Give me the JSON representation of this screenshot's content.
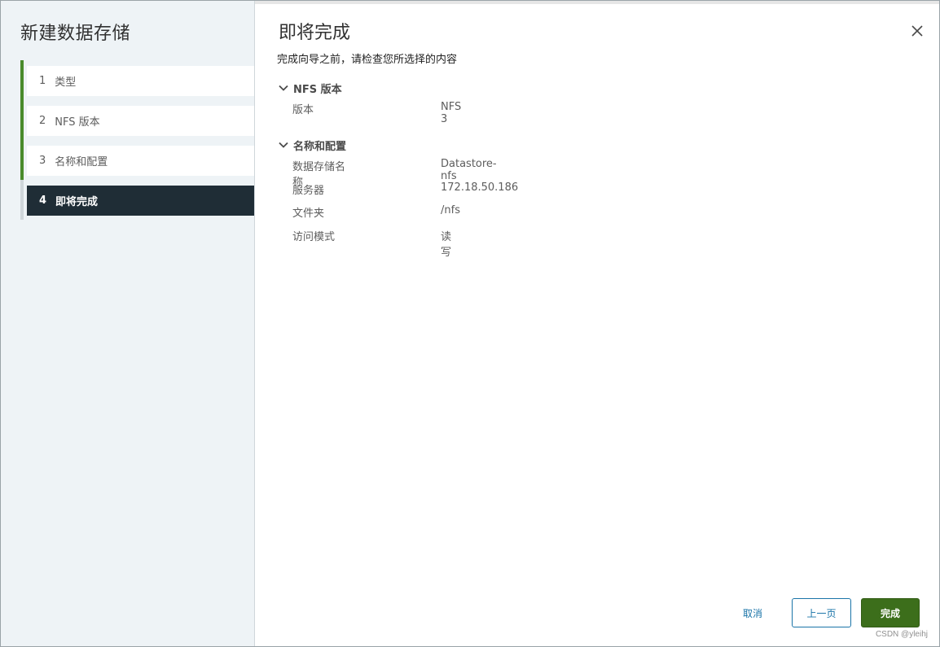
{
  "wizard": {
    "title": "新建数据存储",
    "steps": [
      {
        "num": "1",
        "label": "类型"
      },
      {
        "num": "2",
        "label": "NFS 版本"
      },
      {
        "num": "3",
        "label": "名称和配置"
      },
      {
        "num": "4",
        "label": "即将完成"
      }
    ],
    "active_step": "4"
  },
  "main": {
    "title": "即将完成",
    "subtitle": "完成向导之前，请检查您所选择的内容",
    "sections": [
      {
        "header": "NFS 版本",
        "rows": [
          {
            "key": "版本",
            "value": "NFS 3"
          }
        ]
      },
      {
        "header": "名称和配置",
        "rows": [
          {
            "key": "数据存储名称",
            "value": "Datastore-nfs"
          },
          {
            "key": "服务器",
            "value": "172.18.50.186"
          },
          {
            "key": "文件夹",
            "value": "/nfs"
          },
          {
            "key": "访问模式",
            "value": "读写"
          }
        ]
      }
    ]
  },
  "footer": {
    "cancel_label": "取消",
    "back_label": "上一页",
    "finish_label": "完成"
  },
  "watermark": "CSDN @yleihj",
  "icons": {
    "close": "close-icon",
    "chevron": "chevron-down-icon"
  },
  "colors": {
    "accent_green": "#4a8b2c",
    "active_step_bg": "#1f2d36",
    "link_blue": "#1a74a8",
    "finish_button": "#3c6e1b"
  }
}
